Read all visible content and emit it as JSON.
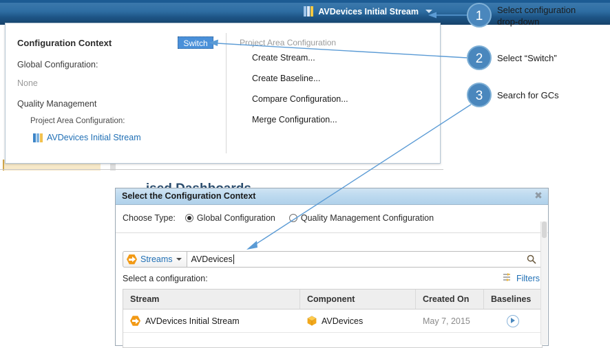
{
  "banner": {
    "config_name": "AVDevices Initial Stream",
    "stream_icon": "stream-bars-icon",
    "caret_icon": "chevron-down-icon"
  },
  "background": {
    "clipped_left_text": "",
    "clipped_right_text": "",
    "clipped_heading": "...ised Dashboards",
    "clipped_tool_icons": ""
  },
  "config_popup": {
    "title": "Configuration Context",
    "switch_label": "Switch",
    "global_configuration_label": "Global Configuration:",
    "global_configuration_value": "None",
    "quality_management_label": "Quality Management",
    "project_area_configuration_label": "Project Area Configuration:",
    "project_area_configuration_value": "AVDevices Initial Stream",
    "menu_header": "Project Area Configuration",
    "menu_items": [
      {
        "label": "Create Stream..."
      },
      {
        "label": "Create Baseline..."
      },
      {
        "label": "Compare Configuration..."
      },
      {
        "label": "Merge Configuration..."
      }
    ]
  },
  "dialog": {
    "title": "Select the Configuration Context",
    "close_icon": "close-icon",
    "choose_type_label": "Choose Type:",
    "type_options": [
      {
        "label": "Global Configuration",
        "selected": true
      },
      {
        "label": "Quality Management Configuration",
        "selected": false
      }
    ],
    "search": {
      "scope_label": "Streams",
      "scope_icon": "stream-hex-icon",
      "caret_icon": "chevron-down-icon",
      "value": "AVDevices",
      "placeholder": "",
      "search_icon": "search-icon"
    },
    "select_configuration_label": "Select a configuration:",
    "filters_label": "Filters",
    "filters_icon": "filters-icon",
    "table": {
      "columns": [
        "Stream",
        "Component",
        "Created On",
        "Baselines"
      ],
      "rows": [
        {
          "stream": "AVDevices Initial Stream",
          "stream_icon": "stream-hex-icon",
          "component": "AVDevices",
          "component_icon": "component-cube-icon",
          "created_on": "May 7, 2015",
          "baselines_icon": "play-circle-icon"
        }
      ]
    }
  },
  "annotations": [
    {
      "number": "1",
      "text": "Select configuration\ndrop-down"
    },
    {
      "number": "2",
      "text": "Select “Switch”"
    },
    {
      "number": "3",
      "text": "Search for GCs"
    }
  ],
  "colors": {
    "banner_blue": "#2e6ea3",
    "accent_blue": "#4a87bd",
    "link_blue": "#1f6fb5",
    "stream_orange": "#f29a16",
    "switch_button": "#4a90d9"
  }
}
